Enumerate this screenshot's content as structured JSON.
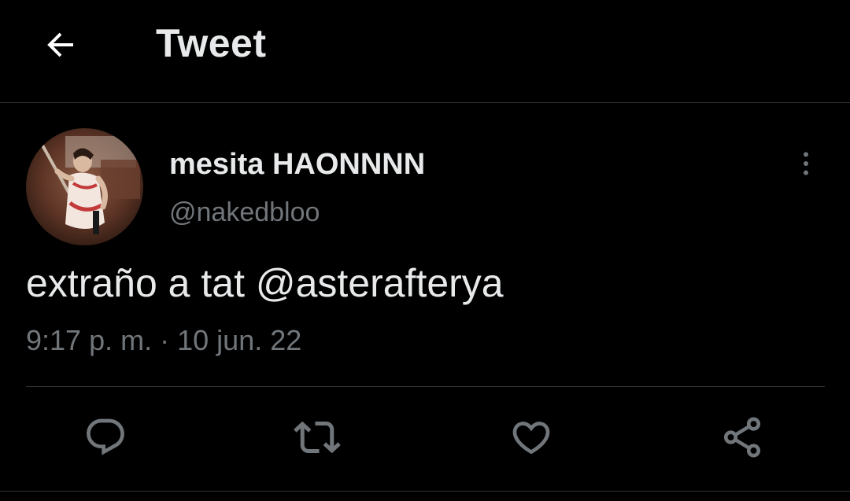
{
  "header": {
    "back_icon": "arrow-left-icon",
    "title": "Tweet"
  },
  "tweet": {
    "author": {
      "display_name": "mesita HAONNNN",
      "handle": "@nakedbloo",
      "avatar_icon": "profile-photo"
    },
    "text": "extraño a tat @asterafterya",
    "time": "9:17 p. m.",
    "separator": "·",
    "date": "10 jun. 22",
    "more_icon": "more-vertical-icon"
  },
  "actions": {
    "reply_icon": "reply-icon",
    "retweet_icon": "retweet-icon",
    "like_icon": "heart-icon",
    "share_icon": "share-icon"
  },
  "colors": {
    "background": "#000000",
    "primary_text": "#e7e9ea",
    "secondary_text": "#71767b",
    "divider": "#2f3336"
  }
}
